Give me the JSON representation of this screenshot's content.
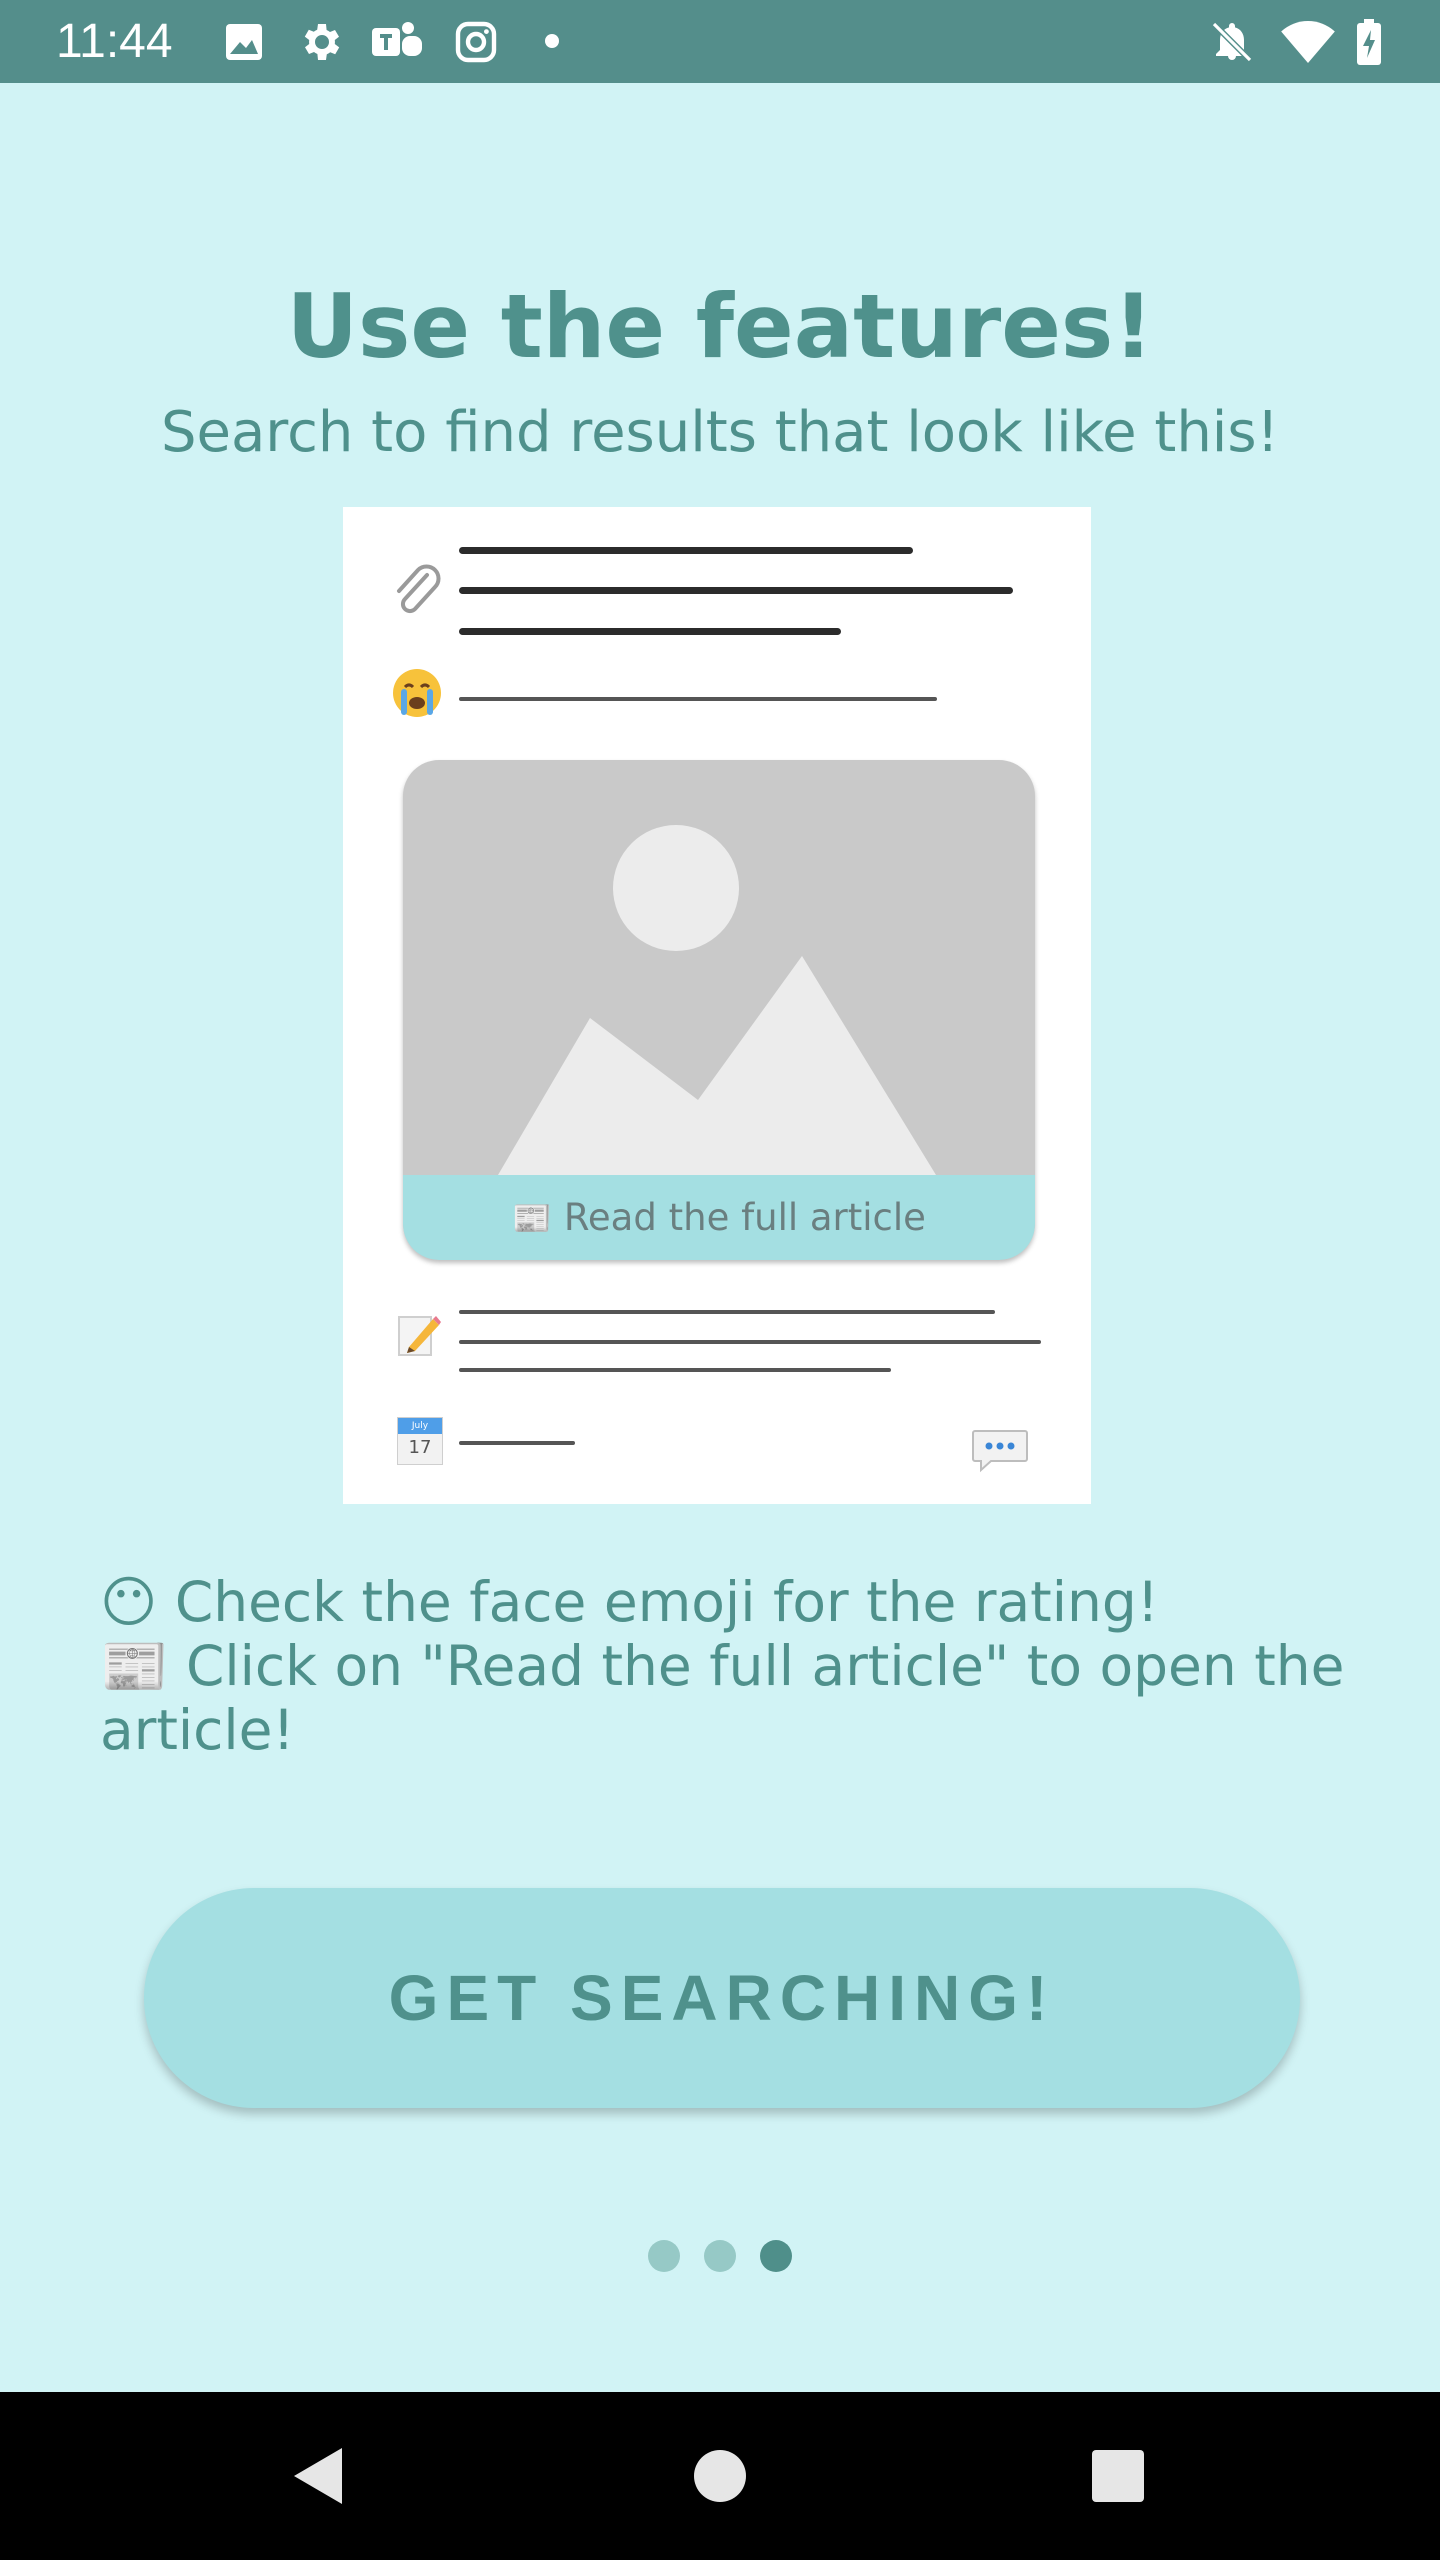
{
  "status_bar": {
    "time": "11:44",
    "left_icons": [
      "image-icon",
      "gear-icon",
      "teams-icon",
      "instagram-icon",
      "notification-dot"
    ],
    "right_icons": [
      "notifications-off-icon",
      "wifi-icon",
      "battery-charging-icon"
    ]
  },
  "header": {
    "title": "Use the features!",
    "subtitle": "Search to find results that look like this!"
  },
  "sample_card": {
    "read_label": "Read the full article",
    "calendar_month": "July",
    "calendar_day": "17",
    "icons": [
      "paperclip-icon",
      "crying-face-icon",
      "image-placeholder-icon",
      "newspaper-icon",
      "pencil-memo-icon",
      "calendar-icon",
      "speech-bubble-icon"
    ]
  },
  "instructions": {
    "line1_emoji": "😶",
    "line1": "Check the face emoji for the rating!",
    "line2_emoji": "📰",
    "line2": "Click on \"Read the full article\" to open the article!"
  },
  "cta": {
    "label": "GET SEARCHING!"
  },
  "pager": {
    "total": 3,
    "active_index": 2
  },
  "nav_bar": {
    "buttons": [
      "back-icon",
      "home-icon",
      "recents-icon"
    ]
  },
  "colors": {
    "background": "#d1f3f5",
    "status_bar": "#548e8b",
    "accent_text": "#4f918c",
    "button": "#a4dfe2",
    "dot_inactive": "#96c9c6",
    "dot_active": "#4f8f8a"
  }
}
